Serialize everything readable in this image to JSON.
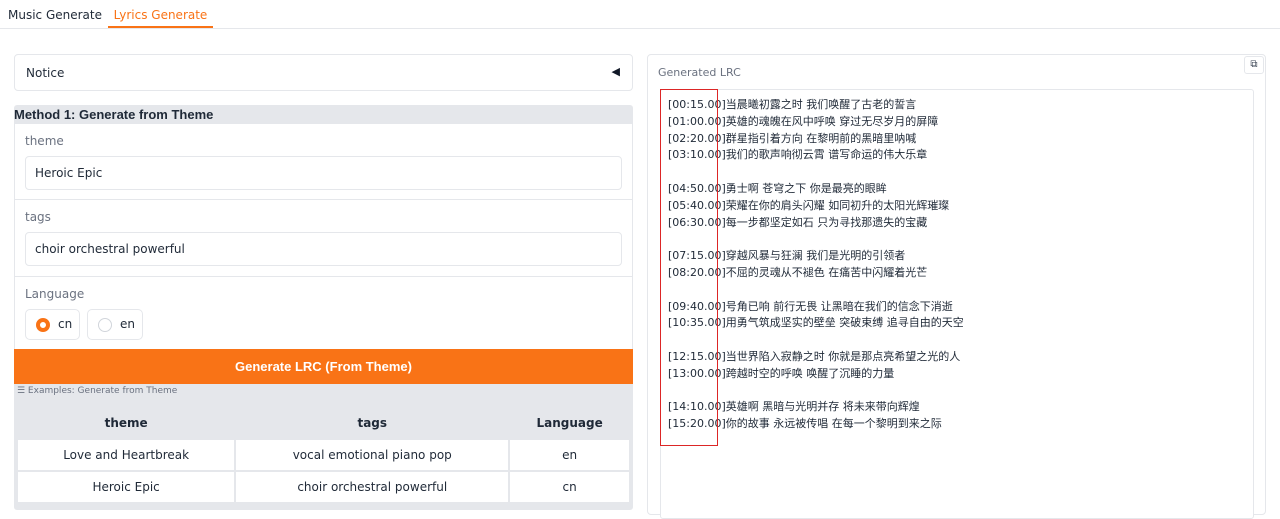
{
  "tabs": [
    {
      "label": "Music Generate",
      "active": false
    },
    {
      "label": "Lyrics Generate",
      "active": true
    }
  ],
  "notice": {
    "label": "Notice",
    "toggle_icon": "triangle-left-icon"
  },
  "method": {
    "title": "Method 1: Generate from Theme",
    "theme": {
      "label": "theme",
      "value": "Heroic Epic"
    },
    "tags": {
      "label": "tags",
      "value": "choir orchestral powerful"
    },
    "language": {
      "label": "Language",
      "options": [
        "cn",
        "en"
      ],
      "selected": "cn"
    },
    "generate_button": "Generate LRC (From Theme)",
    "examples_label": "☰ Examples: Generate from Theme",
    "examples": {
      "headers": [
        "theme",
        "tags",
        "Language"
      ],
      "rows": [
        [
          "Love and Heartbreak",
          "vocal emotional piano pop",
          "en"
        ],
        [
          "Heroic Epic",
          "choir orchestral powerful",
          "cn"
        ]
      ]
    }
  },
  "output": {
    "label": "Generated LRC",
    "copy_icon": "copy-icon",
    "lrc": "[00:15.00]当晨曦初露之时 我们唤醒了古老的誓言\n[01:00.00]英雄的魂魄在风中呼唤 穿过无尽岁月的屏障\n[02:20.00]群星指引着方向 在黎明前的黑暗里呐喊\n[03:10.00]我们的歌声响彻云霄 谱写命运的伟大乐章\n\n[04:50.00]勇士啊 苍穹之下 你是最亮的眼眸\n[05:40.00]荣耀在你的肩头闪耀 如同初升的太阳光辉璀璨\n[06:30.00]每一步都坚定如石 只为寻找那遗失的宝藏\n\n[07:15.00]穿越风暴与狂澜 我们是光明的引领者\n[08:20.00]不屈的灵魂从不褪色 在痛苦中闪耀着光芒\n\n[09:40.00]号角已响 前行无畏 让黑暗在我们的信念下消逝\n[10:35.00]用勇气筑成坚实的壁垒 突破束缚 追寻自由的天空\n\n[12:15.00]当世界陷入寂静之时 你就是那点亮希望之光的人\n[13:00.00]跨越时空的呼唤 唤醒了沉睡的力量\n\n[14:10.00]英雄啊 黑暗与光明并存 将未来带向辉煌\n[15:20.00]你的故事 永远被传唱 在每一个黎明到来之际"
  },
  "colors": {
    "accent": "#f97316",
    "highlight_box": "#dc2626"
  }
}
